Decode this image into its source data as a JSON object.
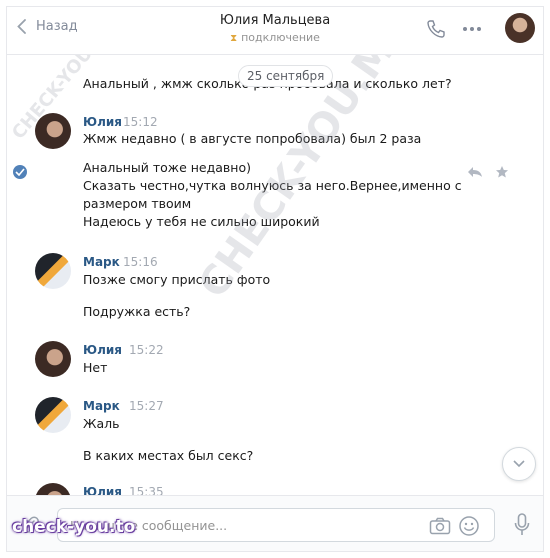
{
  "header": {
    "back_label": "Назад",
    "title": "Юлия Мальцева",
    "subtitle": "подключение"
  },
  "chat": {
    "date_pill": "25 сентября",
    "top_text": "Анальный , жмж сколько раз пробовала и сколько лет?",
    "messages": [
      {
        "author": "Юлия",
        "time": "15:12",
        "lines": [
          "Жмж недавно ( в августе попробовала) был 2 раза"
        ]
      },
      {
        "author": "",
        "time": "",
        "lines": [
          "Анальный тоже недавно)",
          "Сказать честно,чутка волнуюсь за него.Вернее,именно с",
          "размером твоим",
          "Надеюсь у тебя не сильно широкий"
        ]
      },
      {
        "author": "Марк",
        "time": "15:16",
        "lines": [
          "Позже смогу прислать фото"
        ]
      },
      {
        "author": "",
        "time": "",
        "lines": [
          "Подружка есть?"
        ]
      },
      {
        "author": "Юлия",
        "time": "15:22",
        "lines": [
          "Нет"
        ]
      },
      {
        "author": "Марк",
        "time": "15:27",
        "lines": [
          "Жаль"
        ]
      },
      {
        "author": "",
        "time": "",
        "lines": [
          "В каких местах был секс?"
        ]
      },
      {
        "author": "Юлия",
        "time": "15:35",
        "lines": []
      }
    ]
  },
  "composer": {
    "placeholder": "Напишите сообщение..."
  },
  "watermarks": {
    "small": "CHECK-YOU.ME",
    "large": "CHECK-YOU.ME",
    "badge": "check-you.to"
  },
  "colors": {
    "name_link": "#2a5885",
    "check_badge": "#5181b8",
    "muted": "#828a99"
  }
}
